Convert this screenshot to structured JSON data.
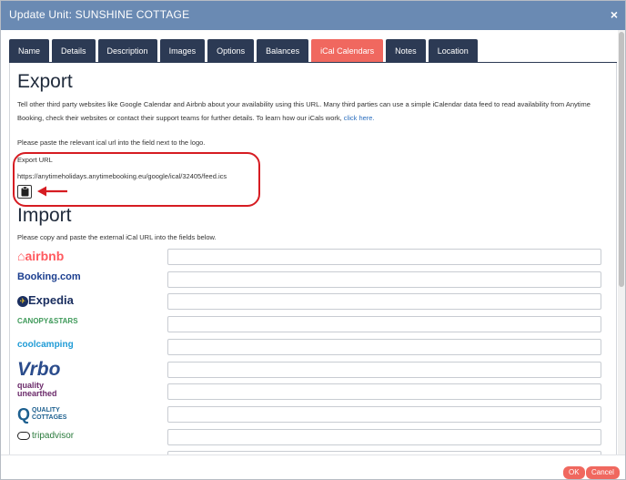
{
  "window": {
    "title": "Update Unit: SUNSHINE COTTAGE",
    "close": "×"
  },
  "tabs": [
    {
      "label": "Name"
    },
    {
      "label": "Details"
    },
    {
      "label": "Description"
    },
    {
      "label": "Images"
    },
    {
      "label": "Options"
    },
    {
      "label": "Balances"
    },
    {
      "label": "iCal Calendars"
    },
    {
      "label": "Notes"
    },
    {
      "label": "Location"
    }
  ],
  "active_tab": "iCal Calendars",
  "export": {
    "heading": "Export",
    "intro": "Tell other third party websites like Google Calendar and Airbnb about your availability using this URL. Many third parties can use a simple iCalendar data feed to read availability from Anytime Booking, check their websites or contact their support teams for further details. To learn how our iCals work,",
    "link": "click here.",
    "instruction": "Please paste the relevant ical url into the field next to the logo.",
    "url_label": "Export URL",
    "url": "https://anytimeholidays.anytimebooking.eu/google/ical/32405/feed.ics"
  },
  "import": {
    "heading": "Import",
    "instruction": "Please copy and paste the external iCal URL into the fields below.",
    "providers": [
      {
        "name": "airbnb"
      },
      {
        "name": "Booking.com"
      },
      {
        "name": "Expedia"
      },
      {
        "name": "CANOPY&STARS"
      },
      {
        "name": "coolcamping"
      },
      {
        "name": "Vrbo"
      },
      {
        "name": "quality unearthed"
      },
      {
        "name": "QUALITY COTTAGES"
      },
      {
        "name": "tripadvisor"
      }
    ]
  },
  "footer": {
    "ok_label": "OK",
    "cancel_label": "Cancel"
  },
  "colors": {
    "titlebar": "#6a8ab3",
    "tab": "#2c3a54",
    "tab_active": "#f0685f",
    "highlight": "#d61c22"
  }
}
